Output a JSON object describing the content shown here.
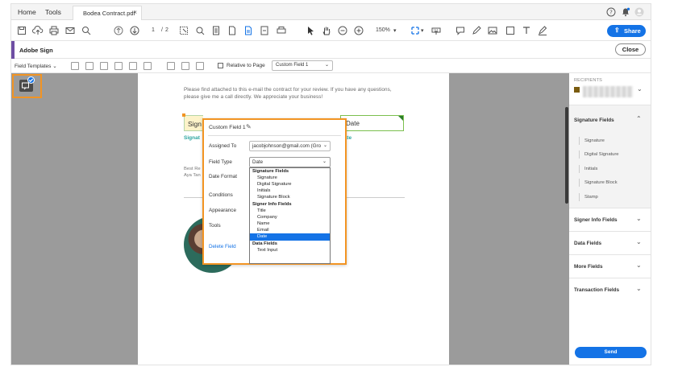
{
  "tabbar": {
    "home": "Home",
    "tools": "Tools",
    "document_tab": "Bodea Contract.pdf",
    "close_glyph": "×"
  },
  "toolbar": {
    "page_current": "1",
    "page_sep": "/",
    "page_total": "2",
    "zoom": "150%",
    "share_label": "Share"
  },
  "signbar": {
    "title": "Adobe Sign",
    "close_label": "Close",
    "accent_color": "#6e4ea3"
  },
  "fieldbar": {
    "templates_label": "Field Templates",
    "relative_label": "Relative to Page",
    "selected_field": "Custom Field 1"
  },
  "document": {
    "paragraph": "Please find attached to this e-mail the contract for your review. If you have any questions, please give me a call directly. We appreciate your business!",
    "signature_field_text": "Sign",
    "signature_caption": "Signat",
    "date_field_text": "Date",
    "date_caption": "Date",
    "regards_line1": "Best Re",
    "regards_line2": "Aya Tan"
  },
  "popup": {
    "field_name": "Custom Field 1",
    "assigned_to_label": "Assigned To",
    "assigned_to_value": "jacobjohnson@gmail.com (Gro",
    "field_type_label": "Field Type",
    "field_type_value": "Date",
    "date_format_label": "Date Format",
    "conditions_label": "Conditions",
    "appearance_label": "Appearance",
    "tools_label": "Tools",
    "delete_label": "Delete Field",
    "dropdown": {
      "group1": "Signature Fields",
      "group1_items": [
        "Signature",
        "Digital Signature",
        "Initials",
        "Signature Block"
      ],
      "group2": "Signer Info Fields",
      "group2_items": [
        "Title",
        "Company",
        "Name",
        "Email",
        "Date"
      ],
      "group3": "Data Fields",
      "group3_items": [
        "Text Input"
      ],
      "selected": "Date"
    }
  },
  "rpanel": {
    "recipients_label": "RECIPIENTS",
    "recipient_color": "#7a5c10",
    "sections": {
      "signature": "Signature Fields",
      "signature_items": [
        "Signature",
        "Digital Signature",
        "Initials",
        "Signature Block",
        "Stamp"
      ],
      "signer_info": "Signer Info Fields",
      "data": "Data Fields",
      "more": "More Fields",
      "transaction": "Transaction Fields"
    },
    "send_label": "Send"
  },
  "colors": {
    "accent_blue": "#1473e6",
    "highlight_orange": "#f29423",
    "caption_teal": "#2aa5a0"
  }
}
